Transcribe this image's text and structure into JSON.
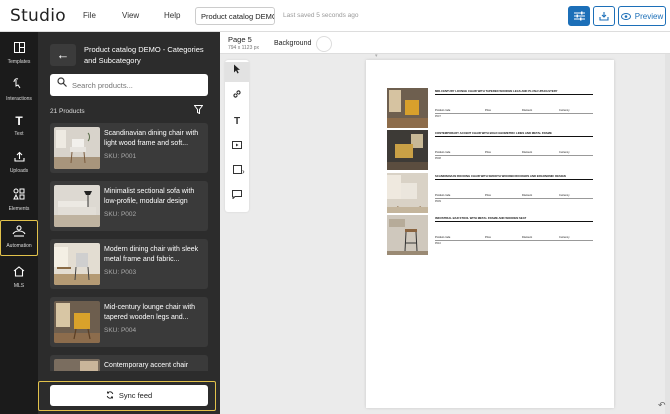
{
  "app": {
    "brand": "Studio",
    "menus": [
      "File",
      "View",
      "Help"
    ],
    "doc_title": "Product catalog DEMO - Categories and Subcategory",
    "save_status": "Last saved 5 seconds ago",
    "preview_label": "Preview"
  },
  "rail": [
    {
      "label": "Templates",
      "icon": "templates-icon"
    },
    {
      "label": "Interactions",
      "icon": "interactions-icon"
    },
    {
      "label": "Text",
      "icon": "text-icon"
    },
    {
      "label": "Uploads",
      "icon": "uploads-icon"
    },
    {
      "label": "Elements",
      "icon": "elements-icon"
    },
    {
      "label": "Automation",
      "icon": "automation-icon",
      "selected": true
    },
    {
      "label": "MLS",
      "icon": "mls-icon"
    }
  ],
  "panel": {
    "title": "Product catalog DEMO - Categories and Subcategory",
    "search_placeholder": "Search products...",
    "count": "21 Products",
    "products": [
      {
        "name": "Scandinavian dining chair with light wood frame and soft...",
        "sku": "SKU: P001"
      },
      {
        "name": "Minimalist sectional sofa with low-profile, modular design",
        "sku": "SKU: P002"
      },
      {
        "name": "Modern dining chair with sleek metal frame and fabric...",
        "sku": "SKU: P003"
      },
      {
        "name": "Mid-century lounge chair with tapered wooden legs and...",
        "sku": "SKU: P004"
      },
      {
        "name": "Contemporary accent chair",
        "sku": ""
      }
    ],
    "sync_label": "Sync feed"
  },
  "page": {
    "name": "Page 5",
    "size": "794 x 1123 px",
    "background_label": "Background"
  },
  "catalog": {
    "columns": [
      "Product code",
      "Price",
      "Discount",
      "Currency"
    ],
    "items": [
      {
        "title": "MID-CENTURY LOUNGE CHAIR WITH TAPERED WOODEN LEGS AND PLUSH UPHOLSTERY",
        "code": "P007"
      },
      {
        "title": "CONTEMPORARY ACCENT CHAIR WITH BOLD GEOMETRIC LINES AND METAL FRAME",
        "code": "P008"
      },
      {
        "title": "SCANDINAVIAN ROCKING CHAIR WITH SMOOTH WOODEN ROCKERS AND ERGONOMIC DESIGN",
        "code": "P009"
      },
      {
        "title": "INDUSTRIAL BAR STOOL WITH METAL FRAME AND WOODEN SEAT",
        "code": "P010"
      }
    ]
  },
  "colors": {
    "accent": "#1c6fb8",
    "highlight": "#e2c24b",
    "panel": "#2c2c2c",
    "rail": "#1b1b1b"
  }
}
